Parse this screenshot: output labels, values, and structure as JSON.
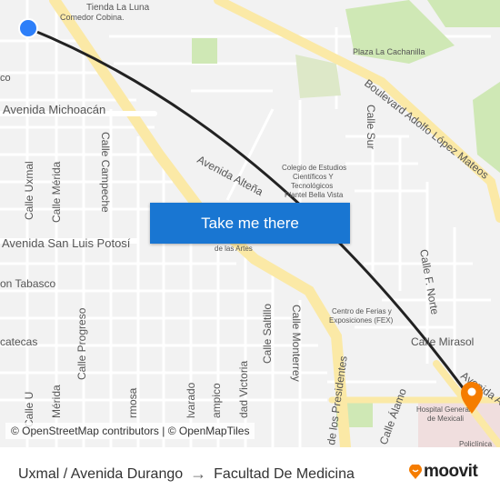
{
  "map": {
    "labels": {
      "tienda": "Tienda La Luna",
      "comedor": "Comedor Cobina.",
      "co": "co",
      "michoacan": "Avenida Michoacán",
      "uxmal": "Calle Uxmal",
      "merida": "Calle Mérida",
      "campeche": "Calle Campeche",
      "slp": "Avenida San Luis Potosí",
      "tabasco": "on Tabasco",
      "zacatecas": "catecas",
      "progreso": "Calle Progreso",
      "altena": "Avenida Alteña",
      "cecyt": [
        "Colegio de Estudios",
        "Científicos Y",
        "Tecnológicos",
        "Plantel Bella Vista"
      ],
      "artes": "de las Artes",
      "cachanilla": "Plaza La Cachanilla",
      "lopez_mateos": "Boulevard Adolfo López Mateos",
      "sur": "Calle Sur",
      "fnorte": "Calle F. Norte",
      "fex": [
        "Centro de Ferias y",
        "Exposiciones (FEX)"
      ],
      "mirasol": "Calle Mirasol",
      "saltillo": "Calle Saltillo",
      "monterrey": "Calle Monterrey",
      "presidentes": "de los Presidentes",
      "alamo": "Calle Álamo",
      "hospital": [
        "Hospital General",
        "de Mexicali"
      ],
      "policlinica": "Policlínica",
      "victoria": "dad Victoria",
      "tampico": "ampico",
      "alvarado": "lvarado",
      "hermosa": "rmosa",
      "merida2": "Mérida",
      "uxmal2": "Calle U",
      "avenida_a": "Avenida A"
    },
    "cta_label": "Take me there",
    "attribution": "© OpenStreetMap contributors | © OpenMapTiles",
    "colors": {
      "origin": "#2d7ff9",
      "destination": "#f57c00",
      "route": "#222222",
      "major_road": "#fbe9a6",
      "park": "#cfe8b5"
    }
  },
  "footer": {
    "origin": "Uxmal / Avenida Durango",
    "arrow": "→",
    "destination": "Facultad De Medicina",
    "brand": "moovit"
  }
}
